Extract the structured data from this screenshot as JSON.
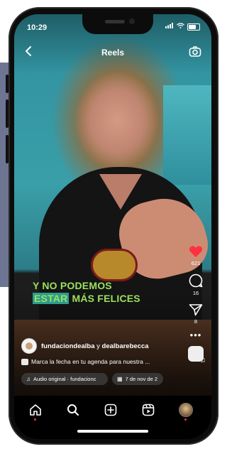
{
  "status_bar": {
    "time": "10:29"
  },
  "header": {
    "title": "Reels"
  },
  "video": {
    "caption_line1": "Y NO PODEMOS",
    "caption_line2_highlight": "ESTAR",
    "caption_line2_rest": " MÁS FELICES"
  },
  "actions": {
    "likes": "621",
    "comments": "16",
    "shares": "8",
    "more": "•••",
    "like_color": "#ff3040"
  },
  "post": {
    "author_primary": "fundaciondealba",
    "author_joiner": " y ",
    "author_secondary": "dealbarebecca",
    "description": "Marca la fecha en tu agenda para nuestra ...",
    "audio_label": "Audio original · fundacionc",
    "event_label": "7 de nov de 2"
  },
  "nav": {
    "items": [
      "home-icon",
      "search-icon",
      "create-icon",
      "reels-icon",
      "profile-avatar"
    ],
    "accent": "#ff3040"
  }
}
